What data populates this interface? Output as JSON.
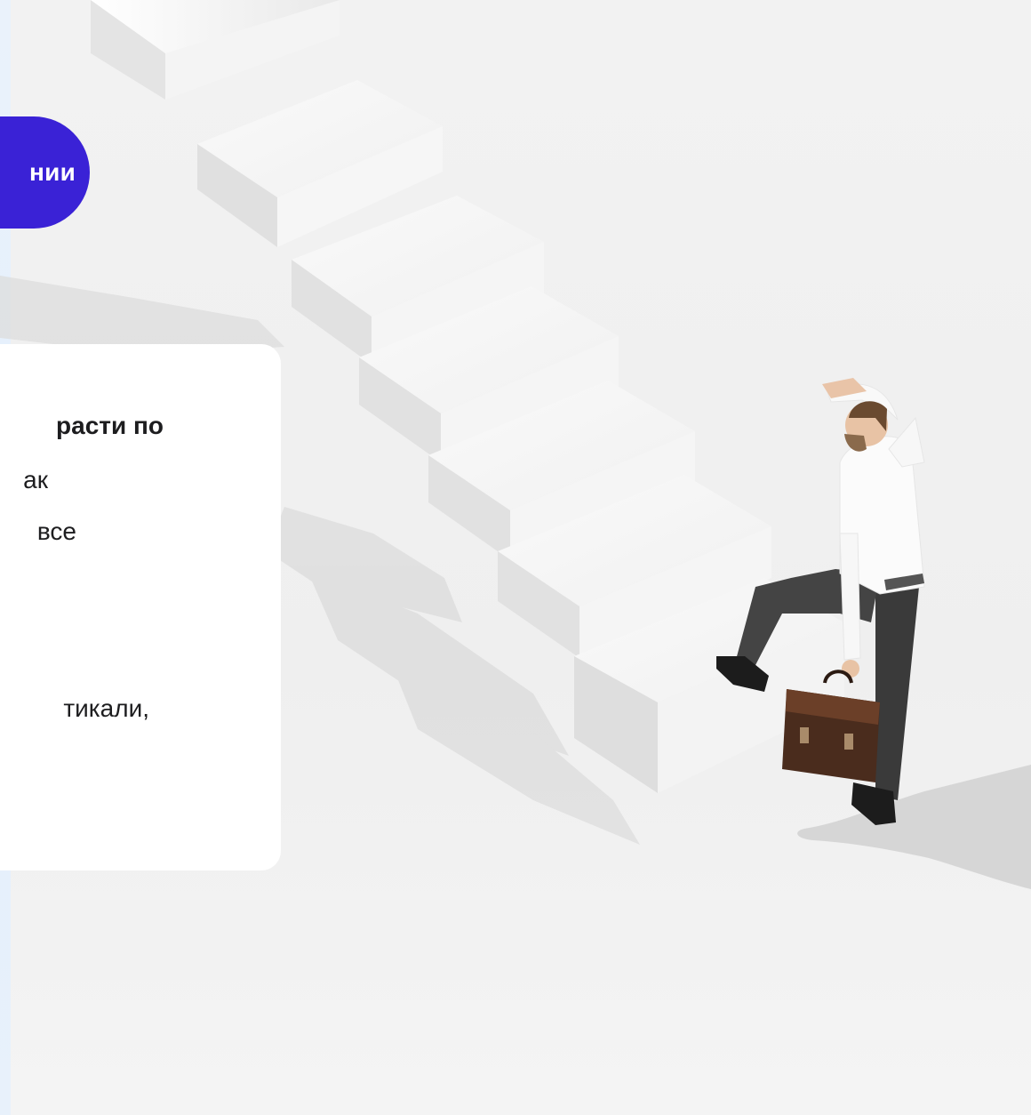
{
  "badge": {
    "label": "нии"
  },
  "card": {
    "lines": [
      "расти по",
      "ак",
      "все",
      "тикали,"
    ]
  },
  "illustration": {
    "icon": "businessman-climbing-stairs"
  }
}
